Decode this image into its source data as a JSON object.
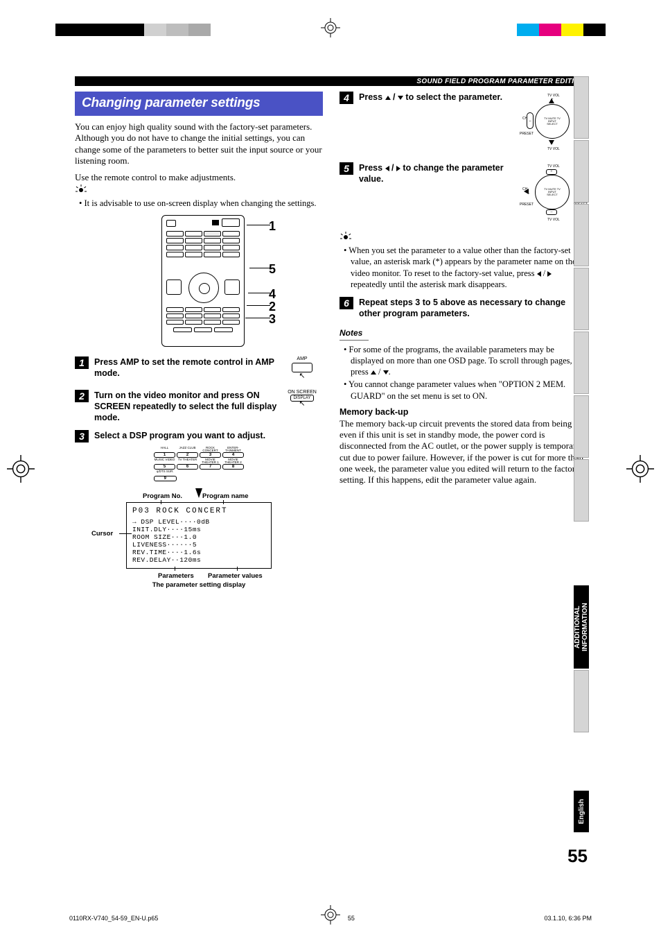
{
  "header_bar": "SOUND FIELD PROGRAM PARAMETER EDITING",
  "section_title": "Changing parameter settings",
  "intro_para": "You can enjoy high quality sound with the factory-set parameters. Although you do not have to change the initial settings, you can change some of the parameters to better suit the input source or your listening room.",
  "remote_note": "Use the remote control to make adjustments.",
  "tip_1": "It is advisable to use on-screen display when changing the settings.",
  "remote_callouts": {
    "r1": "1",
    "r2": "5",
    "r3": "4",
    "r4": "2",
    "r5": "3"
  },
  "steps": {
    "s1": {
      "num": "1",
      "text": "Press AMP to set the remote control in AMP mode.",
      "side_label": "AMP"
    },
    "s2": {
      "num": "2",
      "text": "Turn on the video monitor and press ON SCREEN repeatedly to select the full display mode.",
      "side_label_top": "ON SCREEN",
      "side_label_btn": "DISPLAY"
    },
    "s3": {
      "num": "3",
      "text": "Select a DSP program you want to adjust."
    },
    "s4": {
      "num": "4",
      "text_a": "Press ",
      "text_b": " / ",
      "text_c": " to select the parameter."
    },
    "s5": {
      "num": "5",
      "text_a": "Press ",
      "text_b": " / ",
      "text_c": " to change the parameter value."
    },
    "s6": {
      "num": "6",
      "text": "Repeat steps 3 to 5 above as necessary to change other program parameters."
    }
  },
  "dsp_buttons": {
    "row1": [
      {
        "label": "HALL",
        "num": "1"
      },
      {
        "label": "JAZZ CLUB",
        "num": "2"
      },
      {
        "label": "ROCK CONCERT",
        "num": "3"
      },
      {
        "label": "ENTER-TAINMENT",
        "num": "4"
      }
    ],
    "row2": [
      {
        "label": "MUSIC VIDEO",
        "num": "5"
      },
      {
        "label": "TV THEATER",
        "num": "6"
      },
      {
        "label": "MOVIE THEATER 1",
        "num": "7"
      },
      {
        "label": "MOVIE THEATER 2",
        "num": "8"
      }
    ],
    "row3": [
      {
        "label": "q/DTS SUR.",
        "num": "9"
      }
    ]
  },
  "osd_annotations": {
    "program_no": "Program No.",
    "program_name": "Program name",
    "cursor": "Cursor",
    "parameters": "Parameters",
    "param_values": "Parameter values",
    "caption": "The parameter setting display"
  },
  "osd_display": {
    "title": "P03 ROCK CONCERT",
    "lines": [
      "→ DSP LEVEL····0dB",
      "  INIT.DLY····15ms",
      "  ROOM SIZE···1.0",
      "  LIVENESS······5",
      "  REV.TIME····1.6s",
      "  REV.DELAY··120ms"
    ]
  },
  "tip_2": "When you set the parameter to a value other than the factory-set value, an asterisk mark (*) appears by the parameter name on the video monitor. To reset to the factory-set value, press  /  repeatedly until the asterisk mark disappears.",
  "notes_label": "Notes",
  "notes": [
    "For some of the programs, the available parameters may be displayed on more than one OSD page. To scroll through pages, press  / .",
    "You cannot change parameter values when \"OPTION 2 MEM. GUARD\" on the set menu is set to ON."
  ],
  "memory_backup": {
    "heading": "Memory back-up",
    "text": "The memory back-up circuit prevents the stored data from being lost even if this unit is set in standby mode, the power cord is disconnected from the AC outlet, or the power supply is temporarily cut due to power failure. However, if the power is cut for more than one week, the parameter value you edited will return to the factory setting. If this happens, edit the parameter value again."
  },
  "dial_labels": {
    "tv_vol": "TV VOL",
    "ch": "CH",
    "preset": "PRESET",
    "center": "TV MUTE TV INPUT SELECT",
    "plus": "+",
    "minus": "–"
  },
  "side_tab_1": "ADDITIONAL INFORMATION",
  "side_tab_2": "English",
  "page_number": "55",
  "footer": {
    "file": "0110RX-V740_54-59_EN-U.p65",
    "page": "55",
    "date": "03.1.10, 6:36 PM"
  },
  "colors": {
    "bars_left": [
      "#000000",
      "#000000",
      "#000000",
      "#000000",
      "#cccccc",
      "#b0b0b0",
      "#999999"
    ],
    "bars_right": [
      "#00adef",
      "#e6007e",
      "#fff200",
      "#000000"
    ]
  }
}
